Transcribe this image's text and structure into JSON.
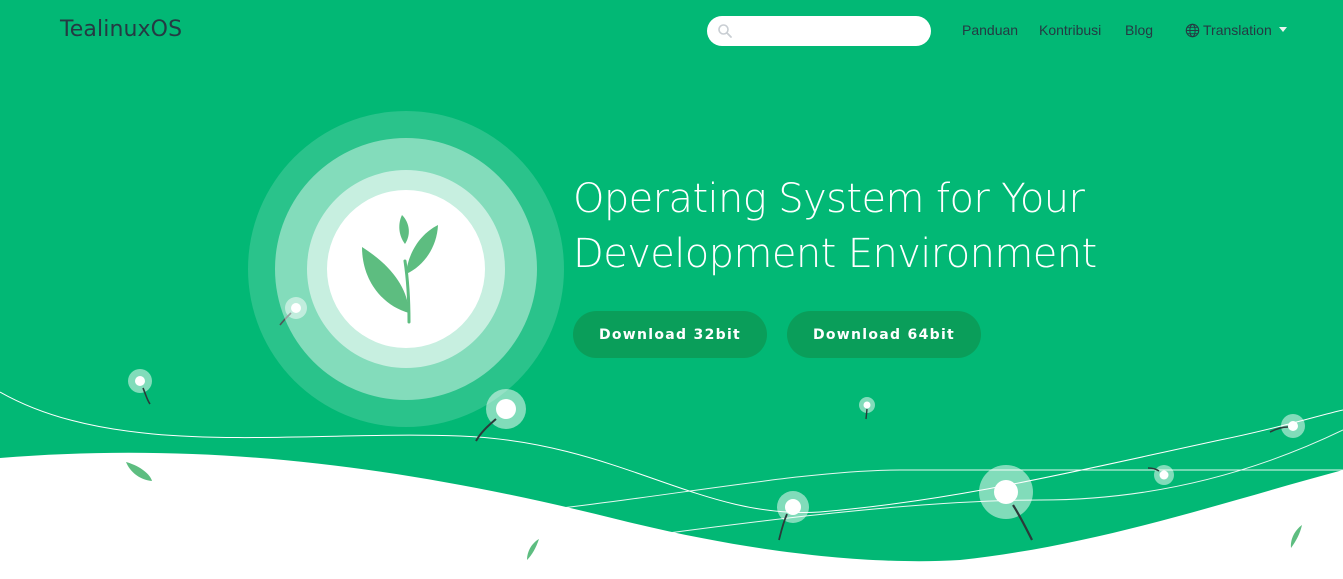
{
  "navbar": {
    "brand": "TealinuxOS",
    "search": {
      "value": "",
      "placeholder": ""
    },
    "links": [
      "Panduan",
      "Kontribusi",
      "Blog"
    ],
    "translation_label": "Translation"
  },
  "hero": {
    "title_line1": "Operating System for Your",
    "title_line2": "Development Environment",
    "buttons": {
      "download_32": "Download 32bit",
      "download_64": "Download 64bit"
    }
  },
  "colors": {
    "background": "#02b875",
    "button": "#0a9e5a",
    "nav_text": "#253a43",
    "leaf": "#5dbd80",
    "white": "#ffffff"
  },
  "icons": [
    "search-icon",
    "globe-icon",
    "caret-down-icon",
    "sprout-logo"
  ]
}
